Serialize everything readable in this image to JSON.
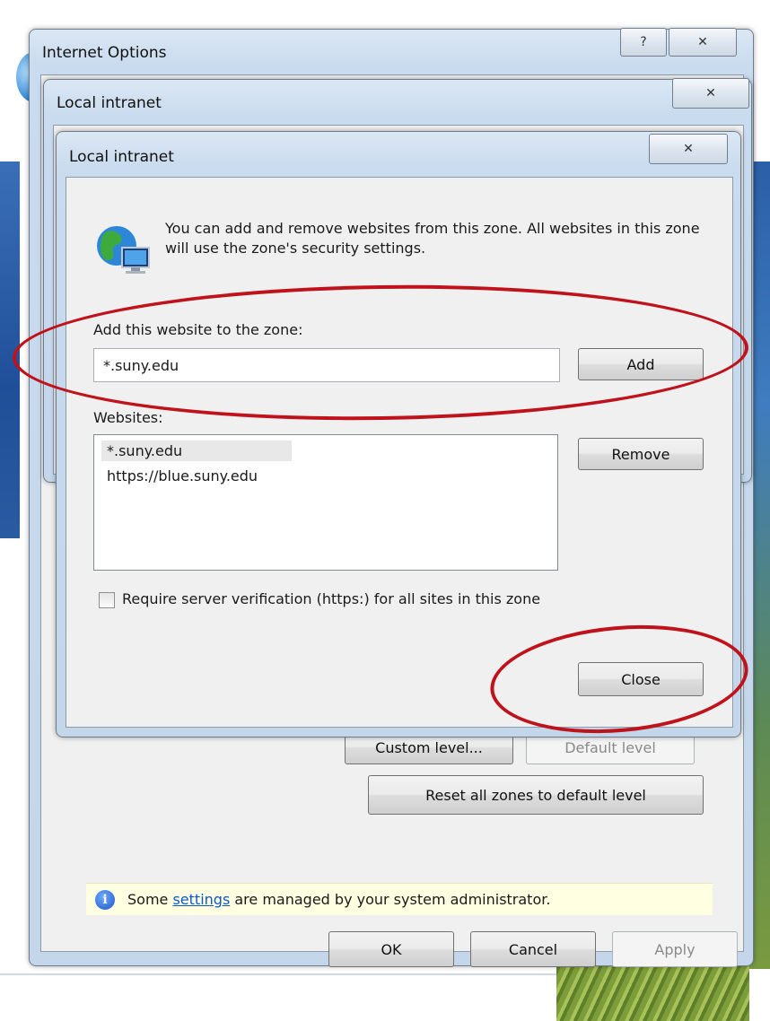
{
  "options_window": {
    "title": "Internet Options",
    "help_glyph": "?",
    "close_glyph": "✕",
    "buttons": {
      "custom_level": "Custom level...",
      "default_level": "Default level",
      "reset_all": "Reset all zones to default level"
    },
    "info": {
      "prefix": "Some ",
      "link": "settings",
      "suffix": " are managed by your system administrator."
    },
    "footer": {
      "ok": "OK",
      "cancel": "Cancel",
      "apply": "Apply"
    }
  },
  "intranet_window": {
    "title": "Local intranet",
    "close_glyph": "✕"
  },
  "sites_dialog": {
    "title": "Local intranet",
    "close_glyph": "✕",
    "description": "You can add and remove websites from this zone. All websites in this zone will use the zone's security settings.",
    "add_label": "Add this website to the zone:",
    "add_value": "*.suny.edu",
    "add_button": "Add",
    "websites_label": "Websites:",
    "websites": [
      "*.suny.edu",
      "https://blue.suny.edu"
    ],
    "remove_button": "Remove",
    "require_https_label": "Require server verification (https:) for all sites in this zone",
    "require_https_checked": false,
    "close_button": "Close"
  },
  "icons": {
    "globe": "globe-monitor-icon",
    "info": "info-icon",
    "help": "help-icon",
    "close": "close-icon"
  },
  "colors": {
    "highlight_oval": "#c0121b",
    "link": "#0b58c7",
    "infobar": "#ffffe1"
  }
}
